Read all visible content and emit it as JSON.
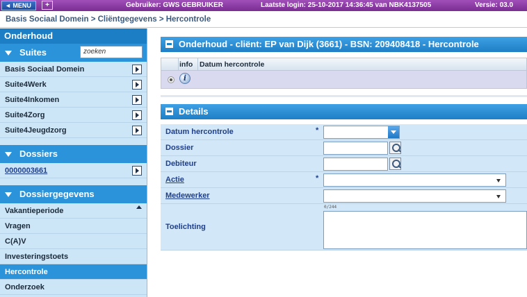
{
  "topbar": {
    "menu_label": "◄ MENU",
    "add_tab_icon": "add-window-icon",
    "user_text": "Gebruiker: GWS GEBRUIKER",
    "login_text": "Laatste login: 25-10-2017 14:36:45 van NBK4137505",
    "version_text": "Versie: 03.0"
  },
  "breadcrumb": "Basis Sociaal Domein > Cliëntgegevens > Hercontrole",
  "sidebar": {
    "title": "Onderhoud",
    "suites": {
      "label": "Suites",
      "search_placeholder": "zoeken",
      "items": [
        "Basis Sociaal Domein",
        "Suite4Werk",
        "Suite4Inkomen",
        "Suite4Zorg",
        "Suite4Jeugdzorg"
      ]
    },
    "dossiers": {
      "label": "Dossiers",
      "items": [
        "0000003661"
      ]
    },
    "dossiergegevens": {
      "label": "Dossiergegevens",
      "items": [
        "Vakantieperiode",
        "Vragen",
        "C(A)V",
        "Investeringstoets",
        "Hercontrole",
        "Onderzoek"
      ],
      "active": "Hercontrole"
    }
  },
  "main": {
    "panel_title": "Onderhoud - cliënt: EP van Dijk (3661) - BSN: 209408418 - Hercontrole",
    "grid": {
      "col_info": "info",
      "col_date": "Datum hercontrole"
    },
    "details": {
      "title": "Details",
      "fields": {
        "datum": "Datum hercontrole",
        "dossier": "Dossier",
        "debiteur": "Debiteur",
        "actie": "Actie",
        "medewerker": "Medewerker",
        "toelichting": "Toelichting"
      },
      "required_mark": "*",
      "counter": "0/244"
    }
  }
}
